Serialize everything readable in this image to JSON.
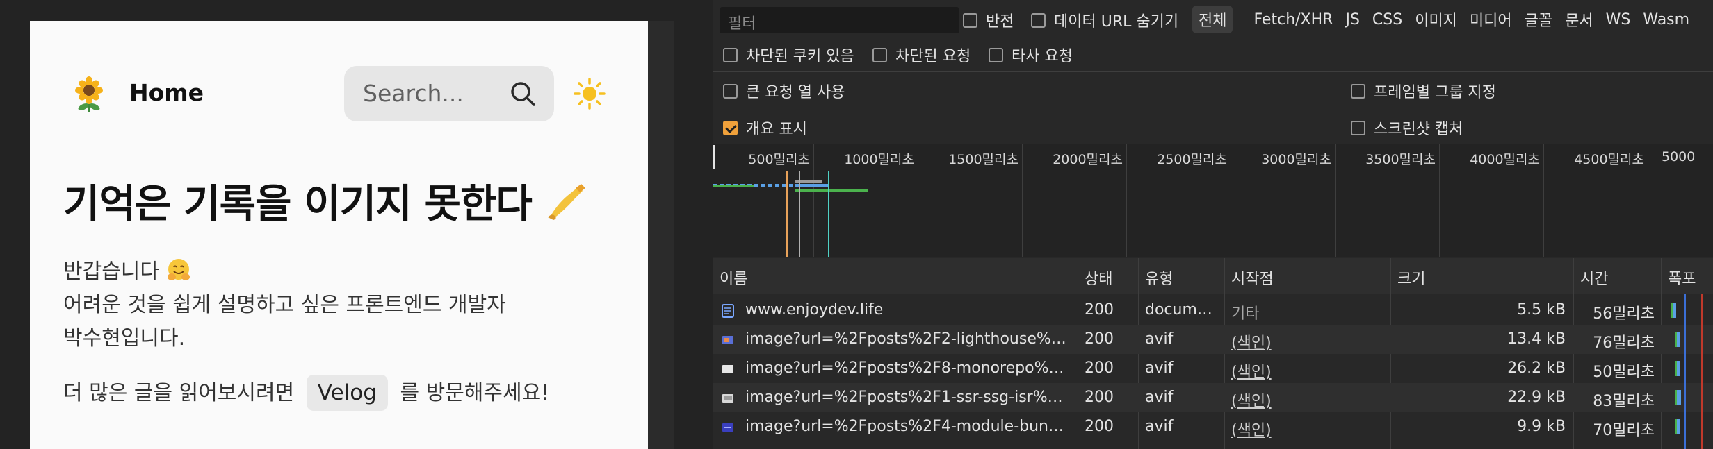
{
  "site": {
    "nav": {
      "home": "Home",
      "search_placeholder": "Search..."
    },
    "title": "기억은 기록을 이기지 못한다",
    "intro": {
      "line1": "반갑습니다",
      "line2": "어려운 것을 쉽게 설명하고 싶은 프론트엔드 개발자",
      "line3": "박수현입니다."
    },
    "more": {
      "before": "더 많은 글을 읽어보시려면",
      "link": "Velog",
      "after": "를 방문해주세요!"
    }
  },
  "devtools": {
    "filter_placeholder": "필터",
    "invert": "반전",
    "hide_data_urls": "데이터 URL 숨기기",
    "types": [
      "전체",
      "Fetch/XHR",
      "JS",
      "CSS",
      "이미지",
      "미디어",
      "글꼴",
      "문서",
      "WS",
      "Wasm"
    ],
    "active_type": "전체",
    "blocked_cookies": "차단된 쿠키 있음",
    "blocked_requests": "차단된 요청",
    "third_party": "타사 요청",
    "large_rows": "큰 요청 열 사용",
    "group_by_frame": "프레임별 그룹 지정",
    "show_overview": "개요 표시",
    "screenshots": "스크린샷 캡처",
    "timeline_ticks": [
      "500밀리초",
      "1000밀리초",
      "1500밀리초",
      "2000밀리초",
      "2500밀리초",
      "3000밀리초",
      "3500밀리초",
      "4000밀리초",
      "4500밀리초",
      "5000"
    ],
    "columns": {
      "name": "이름",
      "status": "상태",
      "type": "유형",
      "initiator": "시작점",
      "size": "크기",
      "time": "시간",
      "waterfall": "폭포"
    },
    "rows": [
      {
        "name": "www.enjoydev.life",
        "status": "200",
        "type": "docum…",
        "initiator": "기타",
        "size": "5.5 kB",
        "time": "56밀리초"
      },
      {
        "name": "image?url=%2Fposts%2F2-lighthouse%…",
        "status": "200",
        "type": "avif",
        "initiator": "(색인)",
        "size": "13.4 kB",
        "time": "76밀리초"
      },
      {
        "name": "image?url=%2Fposts%2F8-monorepo%…",
        "status": "200",
        "type": "avif",
        "initiator": "(색인)",
        "size": "26.2 kB",
        "time": "50밀리초"
      },
      {
        "name": "image?url=%2Fposts%2F1-ssr-ssg-isr%…",
        "status": "200",
        "type": "avif",
        "initiator": "(색인)",
        "size": "22.9 kB",
        "time": "83밀리초"
      },
      {
        "name": "image?url=%2Fposts%2F4-module-bun…",
        "status": "200",
        "type": "avif",
        "initiator": "(색인)",
        "size": "9.9 kB",
        "time": "70밀리초"
      }
    ]
  }
}
